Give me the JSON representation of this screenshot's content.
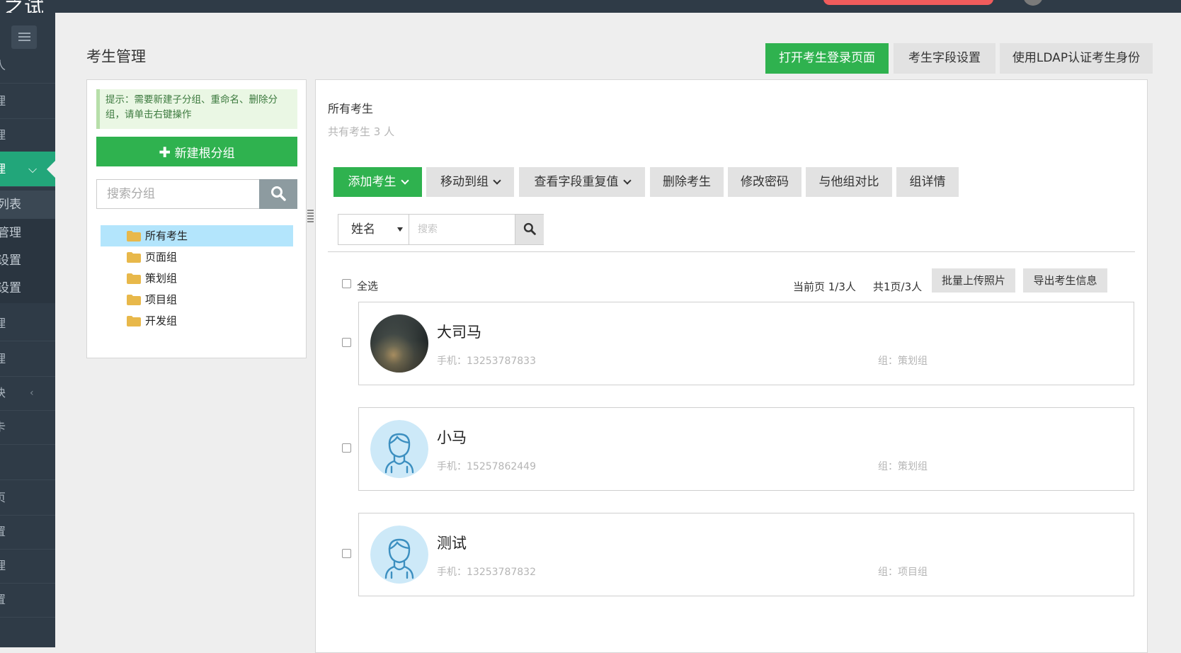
{
  "topbar": {
    "brand": "之试"
  },
  "sidebar": {
    "items": [
      {
        "label": "人"
      },
      {
        "label": "理"
      },
      {
        "label": "理"
      },
      {
        "label": "理",
        "active": true
      },
      {
        "label": "理"
      },
      {
        "label": "理"
      },
      {
        "label": "块"
      },
      {
        "label": "卡"
      },
      {
        "label": ""
      },
      {
        "label": "页"
      },
      {
        "label": "置"
      },
      {
        "label": "理"
      },
      {
        "label": "置"
      }
    ],
    "sub_items": [
      {
        "label": "列表",
        "selected": true
      },
      {
        "label": "管理"
      },
      {
        "label": "设置"
      },
      {
        "label": "设置"
      }
    ]
  },
  "page": {
    "title": "考生管理"
  },
  "top_buttons": {
    "open_login": "打开考生登录页面",
    "field_settings": "考生字段设置",
    "ldap": "使用LDAP认证考生身份"
  },
  "left_panel": {
    "tip": "提示：需要新建子分组、重命名、删除分组，请单击右键操作",
    "new_group": "新建根分组",
    "search_placeholder": "搜索分组",
    "tree": [
      "所有考生",
      "页面组",
      "策划组",
      "项目组",
      "开发组"
    ]
  },
  "right_panel": {
    "title": "所有考生",
    "count": "共有考生 3 人",
    "actions": {
      "add": "添加考生",
      "move": "移动到组",
      "dup": "查看字段重复值",
      "delete": "删除考生",
      "password": "修改密码",
      "compare": "与他组对比",
      "detail": "组详情"
    },
    "filter": {
      "field": "姓名",
      "placeholder": "搜索"
    },
    "select_all": "全选",
    "current_page": "当前页 1/3人",
    "total": "共1页/3人",
    "upload_photos": "批量上传照片",
    "export": "导出考生信息",
    "students": [
      {
        "name": "大司马",
        "phone": "手机：13253787833",
        "group": "组：策划组",
        "avatar": "photo"
      },
      {
        "name": "小马",
        "phone": "手机：15257862449",
        "group": "组：策划组",
        "avatar": "default-avatar-icon"
      },
      {
        "name": "测试",
        "phone": "手机：13253787832",
        "group": "组：项目组",
        "avatar": "default-avatar-icon"
      }
    ]
  },
  "colors": {
    "accent_green": "#2fb24f",
    "sidebar_bg": "#2f3b47",
    "sidebar_active": "#22a67a",
    "tree_selected": "#b3e5fc"
  }
}
